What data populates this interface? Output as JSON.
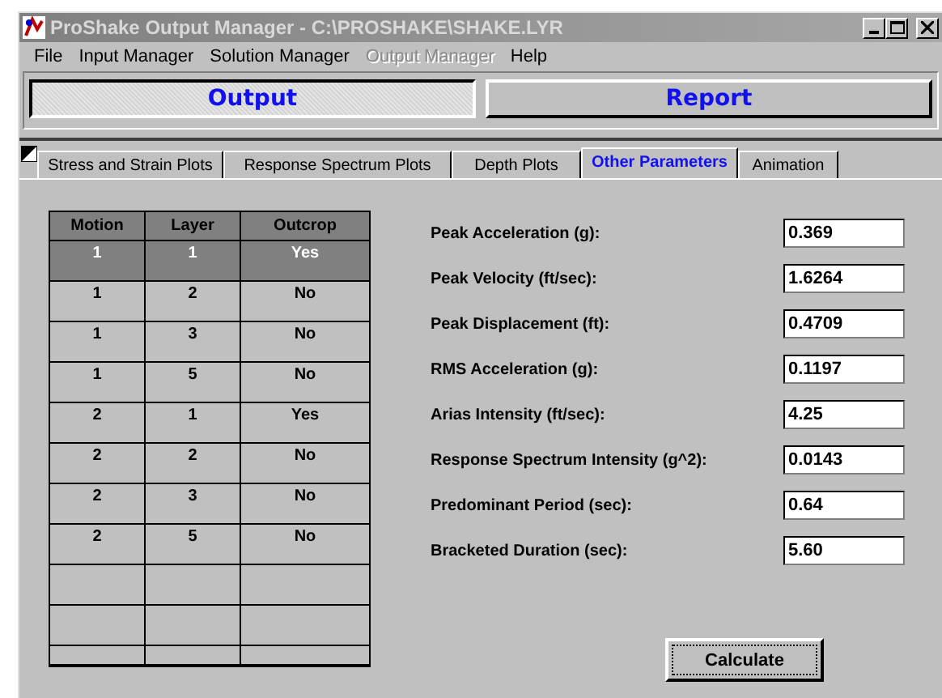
{
  "window": {
    "title": "ProShake Output Manager - C:\\PROSHAKE\\SHAKE.LYR"
  },
  "menu": [
    {
      "label": "File",
      "disabled": false
    },
    {
      "label": "Input Manager",
      "disabled": false
    },
    {
      "label": "Solution Manager",
      "disabled": false
    },
    {
      "label": "Output Manager",
      "disabled": true
    },
    {
      "label": "Help",
      "disabled": false
    }
  ],
  "toolbar": [
    {
      "label": "Output",
      "selected": true
    },
    {
      "label": "Report",
      "selected": false
    }
  ],
  "tabs": [
    {
      "label": "Stress and Strain Plots",
      "selected": false
    },
    {
      "label": "Response Spectrum Plots",
      "selected": false
    },
    {
      "label": "Depth Plots",
      "selected": false
    },
    {
      "label": "Other Parameters",
      "selected": true
    },
    {
      "label": "Animation",
      "selected": false
    }
  ],
  "table": {
    "columns": [
      "Motion",
      "Layer",
      "Outcrop"
    ],
    "rows": [
      {
        "cells": [
          "1",
          "1",
          "Yes"
        ],
        "selected": true
      },
      {
        "cells": [
          "1",
          "2",
          "No"
        ],
        "selected": false
      },
      {
        "cells": [
          "1",
          "3",
          "No"
        ],
        "selected": false
      },
      {
        "cells": [
          "1",
          "5",
          "No"
        ],
        "selected": false
      },
      {
        "cells": [
          "2",
          "1",
          "Yes"
        ],
        "selected": false
      },
      {
        "cells": [
          "2",
          "2",
          "No"
        ],
        "selected": false
      },
      {
        "cells": [
          "2",
          "3",
          "No"
        ],
        "selected": false
      },
      {
        "cells": [
          "2",
          "5",
          "No"
        ],
        "selected": false
      }
    ]
  },
  "parameters": [
    {
      "label": "Peak Acceleration (g):",
      "value": "0.369"
    },
    {
      "label": "Peak Velocity (ft/sec):",
      "value": "1.6264"
    },
    {
      "label": "Peak Displacement (ft):",
      "value": "0.4709"
    },
    {
      "label": "RMS Acceleration (g):",
      "value": "0.1197"
    },
    {
      "label": "Arias Intensity (ft/sec):",
      "value": "4.25"
    },
    {
      "label": "Response Spectrum Intensity (g^2):",
      "value": "0.0143"
    },
    {
      "label": "Predominant Period (sec):",
      "value": "0.64"
    },
    {
      "label": "Bracketed Duration (sec):",
      "value": "5.60"
    }
  ],
  "calculate_button": {
    "label": "Calculate"
  }
}
